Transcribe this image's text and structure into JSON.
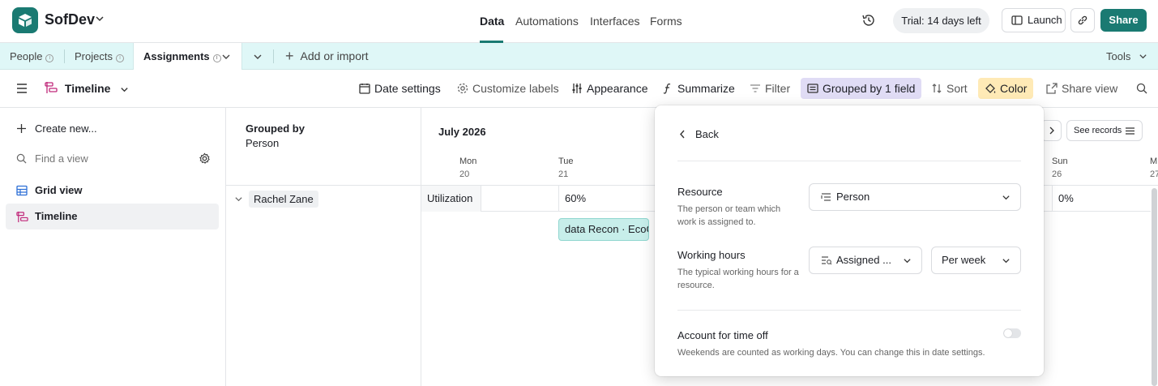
{
  "app": {
    "base_name": "SofDev",
    "trial": "Trial: 14 days left",
    "launch": "Launch",
    "share": "Share",
    "accent": "#1a7a72"
  },
  "topnav": [
    {
      "label": "Data",
      "active": true
    },
    {
      "label": "Automations"
    },
    {
      "label": "Interfaces"
    },
    {
      "label": "Forms"
    }
  ],
  "tables": {
    "tabs": [
      "People",
      "Projects",
      "Assignments"
    ],
    "active": "Assignments",
    "add_or_import": "Add or import",
    "tools": "Tools"
  },
  "toolbar": {
    "view_name": "Timeline",
    "date_settings": "Date settings",
    "customize_labels": "Customize labels",
    "appearance": "Appearance",
    "summarize": "Summarize",
    "filter": "Filter",
    "grouped": "Grouped by 1 field",
    "sort": "Sort",
    "color": "Color",
    "share_view": "Share view"
  },
  "sidebar": {
    "create_new": "Create new...",
    "find_placeholder": "Find a view",
    "views": [
      {
        "label": "Grid view",
        "icon": "grid-icon"
      },
      {
        "label": "Timeline",
        "icon": "timeline-icon",
        "active": true
      }
    ]
  },
  "timeline": {
    "grouped_by_label": "Grouped by",
    "grouped_by_field": "Person",
    "month": "July 2026",
    "see_records": "See records",
    "days": [
      {
        "dow": "Mon",
        "num": "20"
      },
      {
        "dow": "Tue",
        "num": "21"
      },
      {
        "dow": "Sun",
        "num": "26"
      },
      {
        "dow": "M",
        "num": "27"
      }
    ],
    "group": "Rachel Zane",
    "utilization_label": "Utilization",
    "utilization": [
      "60%",
      "0%"
    ],
    "record": "data Recon · EcoG"
  },
  "popover": {
    "back": "Back",
    "resource_label": "Resource",
    "resource_help": "The person or team which work is assigned to.",
    "resource_value": "Person",
    "hours_label": "Working hours",
    "hours_help": "The typical working hours for a resource.",
    "hours_field": "Assigned ...",
    "hours_period": "Per week",
    "timeoff_label": "Account for time off",
    "timeoff_help": "Weekends are counted as working days. You can change this in date settings.",
    "timeoff_on": false
  }
}
